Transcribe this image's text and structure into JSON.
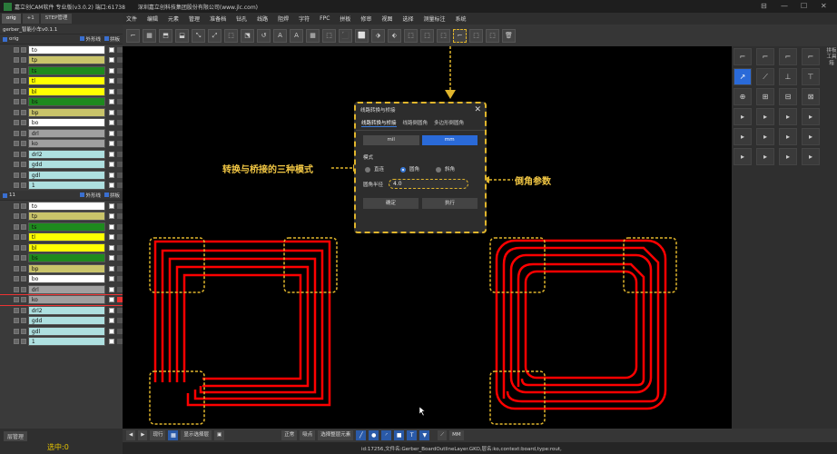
{
  "titlebar": {
    "app": "嘉立创CAM软件 专业版(v3.0.2) 端口:61738",
    "company": "深圳嘉立创科技集团股份有限公司(www.jlc.com)",
    "controls": [
      "⊟",
      "—",
      "☐",
      "✕"
    ]
  },
  "left_tabs": [
    "orig",
    "+1",
    "STEP管理"
  ],
  "job_name": "gerber_智能小车v0.1.1",
  "group1": {
    "name": "orig",
    "outline": "外形线",
    "panel": "拼板"
  },
  "layers1": [
    {
      "name": "to",
      "bg": "#ffffff"
    },
    {
      "name": "tp",
      "bg": "#c9c46a"
    },
    {
      "name": "ts",
      "bg": "#1e8a1e"
    },
    {
      "name": "tl",
      "bg": "#ffff00"
    },
    {
      "name": "bl",
      "bg": "#ffff00"
    },
    {
      "name": "bs",
      "bg": "#1e8a1e"
    },
    {
      "name": "bp",
      "bg": "#c9c46a"
    },
    {
      "name": "bo",
      "bg": "#ffffff"
    },
    {
      "name": "drl",
      "bg": "#a0a0a0"
    },
    {
      "name": "ko",
      "bg": "#a0a0a0"
    },
    {
      "name": "drl2",
      "bg": "#aee0e0"
    },
    {
      "name": "gdd",
      "bg": "#aee0e0"
    },
    {
      "name": "gdl",
      "bg": "#aee0e0"
    },
    {
      "name": "1",
      "bg": "#aee0e0"
    }
  ],
  "group2": {
    "name": "11",
    "outline": "外形线",
    "panel": "拼板"
  },
  "layers2": [
    {
      "name": "to",
      "bg": "#ffffff"
    },
    {
      "name": "tp",
      "bg": "#c9c46a"
    },
    {
      "name": "ts",
      "bg": "#1e8a1e"
    },
    {
      "name": "tl",
      "bg": "#ffff00"
    },
    {
      "name": "bl",
      "bg": "#ffff00"
    },
    {
      "name": "bs",
      "bg": "#1e8a1e"
    },
    {
      "name": "bp",
      "bg": "#c9c46a"
    },
    {
      "name": "bo",
      "bg": "#ffffff"
    },
    {
      "name": "drl",
      "bg": "#a0a0a0"
    },
    {
      "name": "ko",
      "bg": "#a0a0a0"
    },
    {
      "name": "drl2",
      "bg": "#aee0e0"
    },
    {
      "name": "gdd",
      "bg": "#aee0e0"
    },
    {
      "name": "gdl",
      "bg": "#aee0e0"
    },
    {
      "name": "1",
      "bg": "#aee0e0"
    }
  ],
  "layer_manage": "层管理",
  "selected_label": "选中:0",
  "menu": [
    "文件",
    "编辑",
    "元素",
    "管理",
    "准备档",
    "钻孔",
    "线路",
    "阻焊",
    "字符",
    "FPC",
    "拼板",
    "修审",
    "视图",
    "选择",
    "测量标注",
    "系统"
  ],
  "dialog": {
    "title": "线路转换与桥接",
    "close": "✕",
    "tabs": [
      "线路转换与桥接",
      "线路倒圆角",
      "多边形倒圆角"
    ],
    "units": [
      "mil",
      "mm"
    ],
    "mode_label": "模式",
    "modes": [
      "直连",
      "圆角",
      "斜角"
    ],
    "radius_label": "圆角半径",
    "radius_value": "4.0",
    "ok": "确定",
    "run": "执行"
  },
  "annotations": {
    "modes": "转换与桥接的三种模式",
    "radius": "倒角参数"
  },
  "right_labels": "拼板工具箱",
  "bottom": {
    "view": "现行",
    "show_layers": "显示选择层",
    "normal": "正常",
    "snap": "吸点",
    "select_all": "选择整层元素",
    "unit": "MM"
  },
  "status": "id:17256,文件名:Gerber_BoardOutlineLayer.GKO,层名:ko,context:board,type:rout,",
  "colors": {
    "accent": "#2a6ad8",
    "highlight": "#e0b52c",
    "trace": "#ff0000"
  }
}
